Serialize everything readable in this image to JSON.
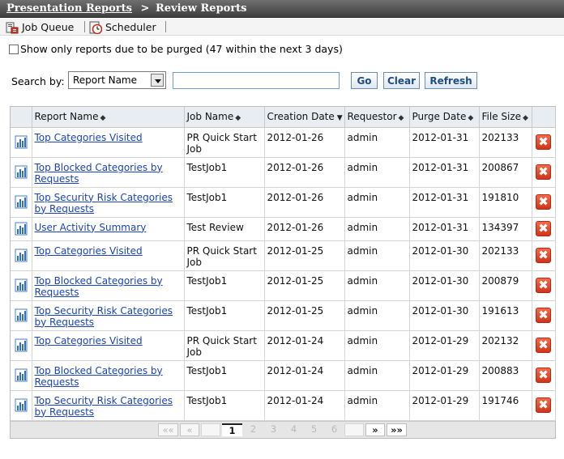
{
  "breadcrumb": {
    "link": "Presentation Reports",
    "separator": ">",
    "current": "Review Reports"
  },
  "toolbar": {
    "job_queue": "Job Queue",
    "scheduler": "Scheduler"
  },
  "purge": {
    "label": "Show only reports due to be purged (47 within the next 3 days)",
    "checked": false
  },
  "search": {
    "label": "Search by:",
    "selected": "Report Name",
    "query": "",
    "go": "Go",
    "clear": "Clear",
    "refresh": "Refresh"
  },
  "table": {
    "columns": [
      "Report Name",
      "Job Name",
      "Creation Date",
      "Requestor",
      "Purge Date",
      "File Size"
    ],
    "sort_column": "Creation Date",
    "rows": [
      [
        "Top Categories Visited",
        "PR Quick Start Job",
        "2012-01-26",
        "admin",
        "2012-01-31",
        "202133"
      ],
      [
        "Top Blocked Categories by Requests",
        "TestJob1",
        "2012-01-26",
        "admin",
        "2012-01-31",
        "200867"
      ],
      [
        "Top Security Risk Categories by Requests",
        "TestJob1",
        "2012-01-26",
        "admin",
        "2012-01-31",
        "191810"
      ],
      [
        "User Activity Summary",
        "Test Review",
        "2012-01-26",
        "admin",
        "2012-01-31",
        "134397"
      ],
      [
        "Top Categories Visited",
        "PR Quick Start Job",
        "2012-01-25",
        "admin",
        "2012-01-30",
        "202133"
      ],
      [
        "Top Blocked Categories by Requests",
        "TestJob1",
        "2012-01-25",
        "admin",
        "2012-01-30",
        "200879"
      ],
      [
        "Top Security Risk Categories by Requests",
        "TestJob1",
        "2012-01-25",
        "admin",
        "2012-01-30",
        "191613"
      ],
      [
        "Top Categories Visited",
        "PR Quick Start Job",
        "2012-01-24",
        "admin",
        "2012-01-29",
        "202132"
      ],
      [
        "Top Blocked Categories by Requests",
        "TestJob1",
        "2012-01-24",
        "admin",
        "2012-01-29",
        "200883"
      ],
      [
        "Top Security Risk Categories by Requests",
        "TestJob1",
        "2012-01-24",
        "admin",
        "2012-01-29",
        "191746"
      ]
    ]
  },
  "pager": {
    "first": "««",
    "prev": "«",
    "pages": [
      "1",
      "2",
      "3",
      "4",
      "5",
      "6"
    ],
    "current": "1",
    "next": "»",
    "last": "»»"
  },
  "icons": {
    "report": "bar-chart-report-icon",
    "delete": "delete-x-icon",
    "job_queue": "job-queue-icon",
    "scheduler": "scheduler-clock-icon"
  },
  "colors": {
    "title_bar": "#4a4a4a",
    "link": "#1a44b8",
    "button_text": "#1c4d88",
    "delete": "#e0401f",
    "header_bg": "#e9edf2"
  }
}
